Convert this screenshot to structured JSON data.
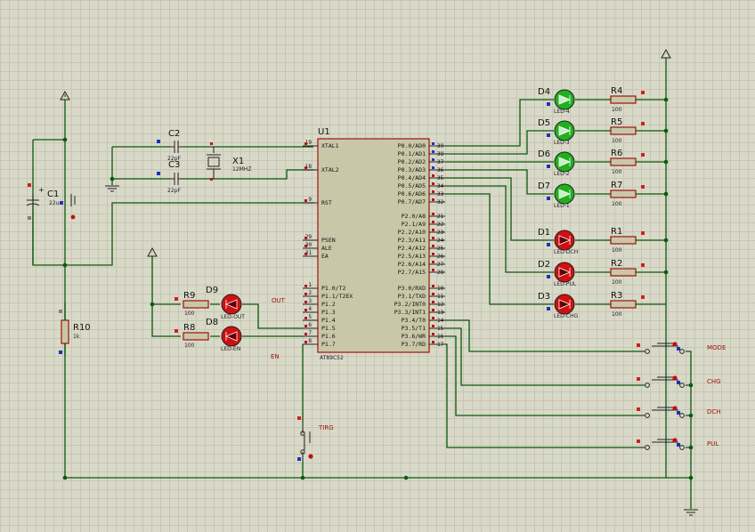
{
  "colors": {
    "background": "#d9d9c9",
    "grid": "#c6c6b2",
    "wire": "#0a5a0a",
    "chip_fill": "#c8c8a8",
    "component_outline": "#a01010",
    "led_green": "#1fb01f",
    "led_red": "#d01010",
    "resistor_fill": "#c8c8a8"
  },
  "mcu": {
    "ref": "U1",
    "part": "AT89C52",
    "left_pins": [
      {
        "num": "19",
        "name": "XTAL1"
      },
      {
        "num": "18",
        "name": "XTAL2"
      },
      {
        "num": "9",
        "name": "RST"
      },
      {
        "num": "29",
        "name": "PSEN"
      },
      {
        "num": "30",
        "name": "ALE"
      },
      {
        "num": "31",
        "name": "EA"
      },
      {
        "num": "1",
        "name": "P1.0/T2"
      },
      {
        "num": "2",
        "name": "P1.1/T2EX"
      },
      {
        "num": "3",
        "name": "P1.2"
      },
      {
        "num": "4",
        "name": "P1.3"
      },
      {
        "num": "5",
        "name": "P1.4"
      },
      {
        "num": "6",
        "name": "P1.5"
      },
      {
        "num": "7",
        "name": "P1.6"
      },
      {
        "num": "8",
        "name": "P1.7"
      }
    ],
    "right_pins": [
      {
        "num": "39",
        "name": "P0.0/AD0"
      },
      {
        "num": "38",
        "name": "P0.1/AD1"
      },
      {
        "num": "37",
        "name": "P0.2/AD2"
      },
      {
        "num": "36",
        "name": "P0.3/AD3"
      },
      {
        "num": "35",
        "name": "P0.4/AD4"
      },
      {
        "num": "34",
        "name": "P0.5/AD5"
      },
      {
        "num": "33",
        "name": "P0.6/AD6"
      },
      {
        "num": "32",
        "name": "P0.7/AD7"
      },
      {
        "num": "21",
        "name": "P2.0/A8"
      },
      {
        "num": "22",
        "name": "P2.1/A9"
      },
      {
        "num": "23",
        "name": "P2.2/A10"
      },
      {
        "num": "24",
        "name": "P2.3/A11"
      },
      {
        "num": "25",
        "name": "P2.4/A12"
      },
      {
        "num": "26",
        "name": "P2.5/A13"
      },
      {
        "num": "27",
        "name": "P2.6/A14"
      },
      {
        "num": "28",
        "name": "P2.7/A15"
      },
      {
        "num": "10",
        "name": "P3.0/RXD"
      },
      {
        "num": "11",
        "name": "P3.1/TXD"
      },
      {
        "num": "12",
        "name": "P3.2/INT0"
      },
      {
        "num": "13",
        "name": "P3.3/INT1"
      },
      {
        "num": "14",
        "name": "P3.4/T0"
      },
      {
        "num": "15",
        "name": "P3.5/T1"
      },
      {
        "num": "16",
        "name": "P3.6/WR"
      },
      {
        "num": "17",
        "name": "P3.7/RD"
      }
    ]
  },
  "capacitors": {
    "c1": {
      "ref": "C1",
      "value": "22u"
    },
    "c2": {
      "ref": "C2",
      "value": "22pF"
    },
    "c3": {
      "ref": "C3",
      "value": "22pF"
    }
  },
  "crystal": {
    "ref": "X1",
    "value": "12MHZ"
  },
  "r10": {
    "ref": "R10",
    "value": "1k"
  },
  "leds_right": [
    {
      "ref": "D4",
      "label": "LED-4",
      "res": "R4",
      "res_value": "100",
      "color": "green"
    },
    {
      "ref": "D5",
      "label": "LED-3",
      "res": "R5",
      "res_value": "100",
      "color": "green"
    },
    {
      "ref": "D6",
      "label": "LED-2",
      "res": "R6",
      "res_value": "100",
      "color": "green"
    },
    {
      "ref": "D7",
      "label": "LED-1",
      "res": "R7",
      "res_value": "100",
      "color": "green"
    },
    {
      "ref": "D1",
      "label": "LED-DCH",
      "res": "R1",
      "res_value": "100",
      "color": "red"
    },
    {
      "ref": "D2",
      "label": "LED-PUL",
      "res": "R2",
      "res_value": "100",
      "color": "red"
    },
    {
      "ref": "D3",
      "label": "LED-CHG",
      "res": "R3",
      "res_value": "100",
      "color": "red"
    }
  ],
  "leds_left": [
    {
      "ref": "D9",
      "label": "LED-OUT",
      "res": "R9",
      "res_value": "100",
      "net": "OUT"
    },
    {
      "ref": "D8",
      "label": "LED-EN",
      "res": "R8",
      "res_value": "100",
      "net": "EN"
    }
  ],
  "buttons": [
    {
      "label": "MODE"
    },
    {
      "label": "CHG"
    },
    {
      "label": "DCH"
    },
    {
      "label": "PUL"
    }
  ],
  "trig_button": {
    "label": "TIRG"
  }
}
